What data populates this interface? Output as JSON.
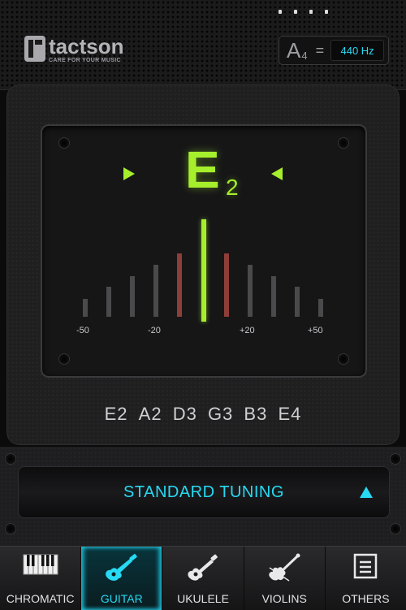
{
  "brand": {
    "name": "tactson",
    "tagline": "CARE FOR YOUR MUSIC"
  },
  "reference": {
    "note": "A",
    "octave": "4",
    "equals": "=",
    "value": "440 Hz"
  },
  "tuner": {
    "note": "E",
    "octave": "2",
    "cents_deviation": 0,
    "scale_labels": [
      "-50",
      "-20",
      "+20",
      "+50"
    ]
  },
  "strings": [
    "E2",
    "A2",
    "D3",
    "G3",
    "B3",
    "E4"
  ],
  "tuning": {
    "label": "STANDARD TUNING"
  },
  "tabs": [
    {
      "label": "CHROMATIC",
      "icon": "piano-icon",
      "active": false
    },
    {
      "label": "GUITAR",
      "icon": "guitar-icon",
      "active": true
    },
    {
      "label": "UKULELE",
      "icon": "ukulele-icon",
      "active": false
    },
    {
      "label": "VIOLINS",
      "icon": "violin-icon",
      "active": false
    },
    {
      "label": "OTHERS",
      "icon": "list-icon",
      "active": false
    }
  ],
  "colors": {
    "note_green": "#a6ef2c",
    "accent_cyan": "#27d9f2",
    "bar_red": "#8e3e39"
  }
}
